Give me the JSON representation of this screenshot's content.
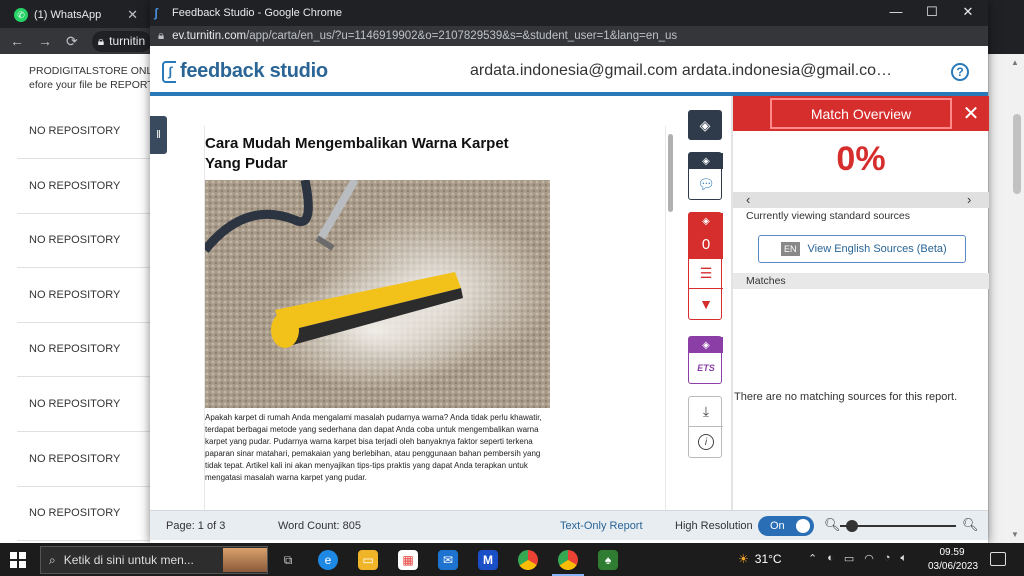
{
  "back_window": {
    "tab_title": "(1) WhatsApp",
    "url_fragment": "turnitin",
    "top_text_1": "PRODIGITALSTORE ONL",
    "top_text_2": "efore your file be REPORT",
    "repository_rows": [
      "NO REPOSITORY",
      "NO REPOSITORY",
      "NO REPOSITORY",
      "NO REPOSITORY",
      "NO REPOSITORY",
      "NO REPOSITORY",
      "NO REPOSITORY",
      "NO REPOSITORY"
    ]
  },
  "window": {
    "title": "Feedback Studio - Google Chrome",
    "url_host": "ev.turnitin.com",
    "url_path": "/app/carta/en_us/?u=1146919902&o=2107829539&s=&student_user=1&lang=en_us",
    "controls": {
      "minimize": "—",
      "maximize": "☐",
      "close": "✕"
    }
  },
  "header": {
    "logo_text": "feedback studio",
    "user_emails": "ardata.indonesia@gmail.com ardata.indonesia@gmail.co…",
    "help_glyph": "?"
  },
  "document": {
    "title": "Cara Mudah Mengembalikan Warna Karpet Yang Pudar",
    "body": "Apakah karpet di rumah Anda mengalami masalah pudarnya warna? Anda tidak perlu khawatir, terdapat berbagai metode yang sederhana dan dapat Anda coba untuk mengembalikan warna karpet yang pudar. Pudarnya warna karpet bisa terjadi oleh banyaknya faktor seperti terkena paparan sinar matahari, pemakaian yang berlebihan, atau penggunaan bahan pembersih yang tidak tepat. Artikel kali ini akan menyajikan tips-tips praktis yang dapat Anda terapkan untuk mengatasi masalah warna karpet yang pudar."
  },
  "tools": {
    "similarity_count": "0",
    "ets_label": "ETS",
    "info_glyph": "i"
  },
  "match_overview": {
    "title": "Match Overview",
    "percent": "0%",
    "viewing_text": "Currently viewing standard sources",
    "english_badge": "EN",
    "english_button": "View English Sources (Beta)",
    "matches_label": "Matches",
    "no_matches": "There are no matching sources for this report."
  },
  "footer": {
    "page": "Page: 1 of 3",
    "word_count": "Word Count: 805",
    "text_only": "Text-Only Report",
    "high_res": "High Resolution",
    "toggle": "On"
  },
  "taskbar": {
    "search_placeholder": "Ketik di sini untuk men...",
    "temperature": "31°C",
    "time": "09.59",
    "date": "03/06/2023"
  },
  "colors": {
    "accent_red": "#d62d2d",
    "turnitin_blue": "#2a7ab9",
    "chrome_dark": "#202124"
  }
}
